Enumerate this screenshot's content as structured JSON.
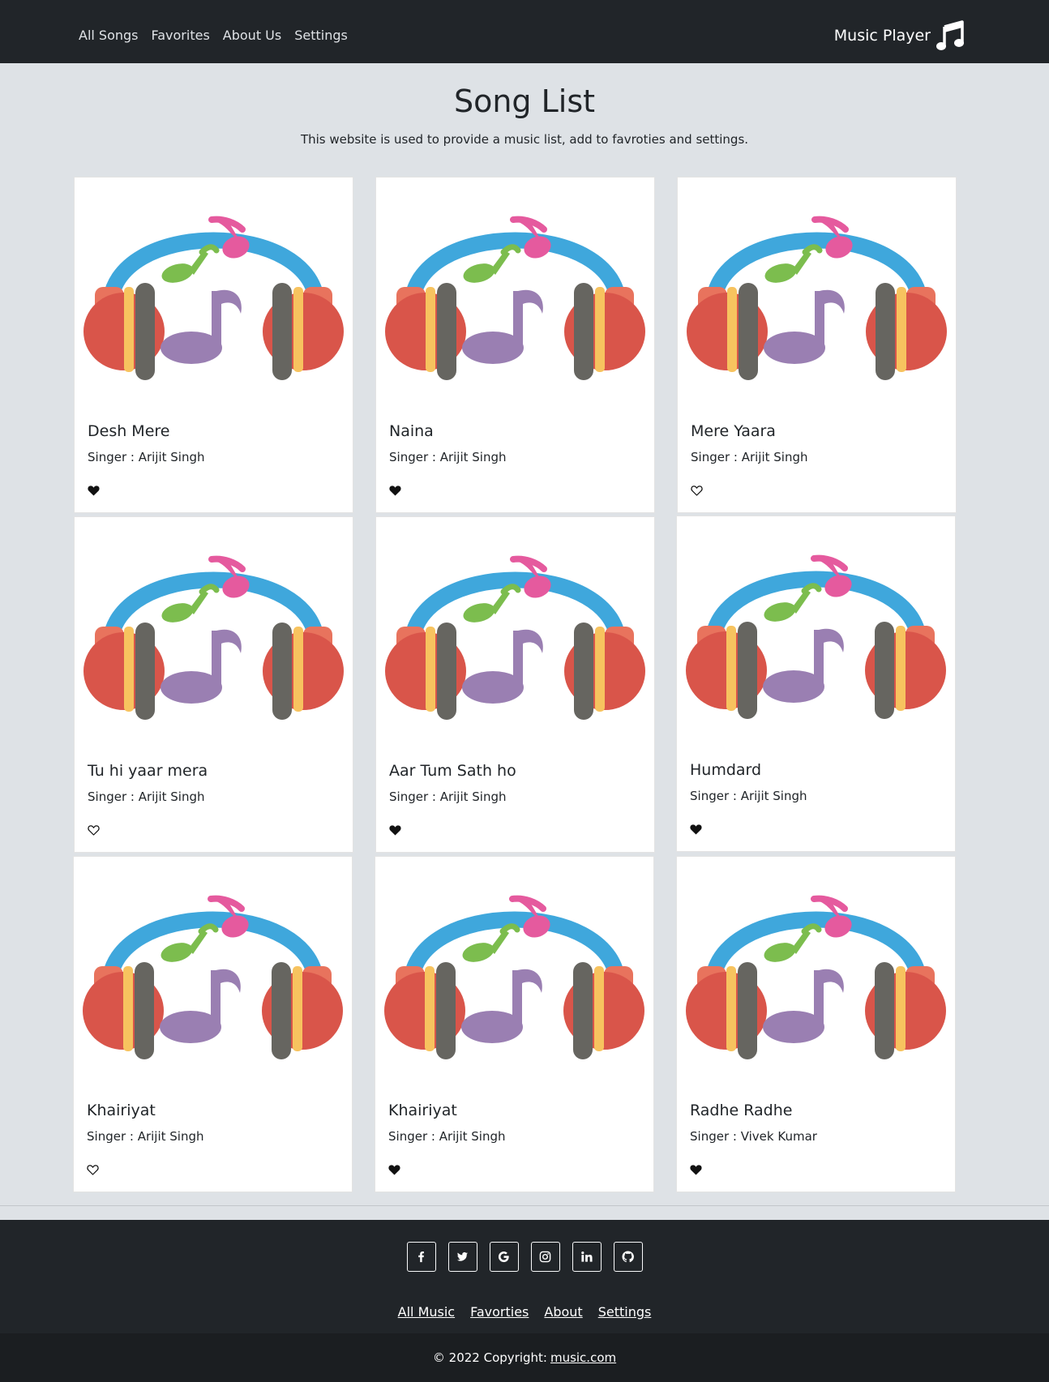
{
  "navbar": {
    "links": [
      "All Songs",
      "Favorites",
      "About Us",
      "Settings"
    ],
    "brand": "Music Player",
    "brand_icon": "music-note-icon"
  },
  "header": {
    "title": "Song List",
    "subtitle": "This website is used to provide a music list, add to favroties and settings."
  },
  "songs": [
    {
      "title": "Desh Mere",
      "singer": "Singer : Arijit Singh",
      "favorite": true
    },
    {
      "title": "Naina",
      "singer": "Singer : Arijit Singh",
      "favorite": true
    },
    {
      "title": "Mere Yaara",
      "singer": "Singer : Arijit Singh",
      "favorite": false
    },
    {
      "title": "Tu hi yaar mera",
      "singer": "Singer : Arijit Singh",
      "favorite": false
    },
    {
      "title": "Aar Tum Sath ho",
      "singer": "Singer : Arijit Singh",
      "favorite": true
    },
    {
      "title": "Humdard",
      "singer": "Singer : Arijit Singh",
      "favorite": true
    },
    {
      "title": "Khairiyat",
      "singer": "Singer : Arijit Singh",
      "favorite": false
    },
    {
      "title": "Khairiyat",
      "singer": "Singer : Arijit Singh",
      "favorite": true
    },
    {
      "title": "Radhe Radhe",
      "singer": "Singer : Vivek Kumar",
      "favorite": true
    }
  ],
  "footer": {
    "socials": [
      "facebook-icon",
      "twitter-icon",
      "google-icon",
      "instagram-icon",
      "linkedin-icon",
      "github-icon"
    ],
    "links": [
      "All Music",
      "Favorties",
      "About",
      "Settings"
    ],
    "copyright_prefix": "© 2022 Copyright:",
    "copyright_link": "music.com"
  },
  "colors": {
    "navbar_bg": "#212529",
    "page_bg": "#dee2e6",
    "headphone_band": "#3fa7dc",
    "ear_cup": "#d9554a",
    "note_pink": "#e55a9e",
    "note_green": "#7cbd4e",
    "note_purple": "#9a7fb2"
  }
}
